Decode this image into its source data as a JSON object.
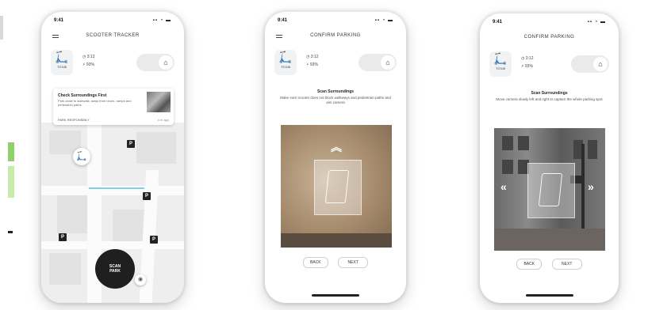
{
  "common": {
    "status_icons": "▪▪ ◔ ▬",
    "scooter_glyph": "🛴",
    "plate": "TC9J8",
    "time_stat": "◷ 3:12",
    "battery_stat": "⚡ 93%",
    "lock_glyph": "⌂"
  },
  "phone1": {
    "time": "9:41",
    "header": "SCOOTER TRACKER",
    "card": {
      "title": "Check Surroundings First",
      "desc": "Park close to sidewalk, away from doors, ramps and pedestrian paths",
      "foot": "PARK RESPONSIBLY",
      "dist": "4 m ago"
    },
    "parking": "P",
    "scan_label": "SCAN\nPARK",
    "locate_icon": "◉"
  },
  "phone2": {
    "time": "9:41",
    "header": "CONFIRM PARKING",
    "title": "Scan Surroundings",
    "text": "Make sure scooter does not block walkways and pedestrian paths and aim camera",
    "chevron_up": "︽",
    "btn_left": "BACK",
    "btn_right": "NEXT"
  },
  "phone3": {
    "time": "9:41",
    "header": "CONFIRM PARKING",
    "title": "Scan Surroundings",
    "text": "Move camera slowly left and right to capture the whole parking spot",
    "chevron_left": "«",
    "chevron_right": "»",
    "btn_left": "BACK",
    "btn_right": "NEXT"
  }
}
